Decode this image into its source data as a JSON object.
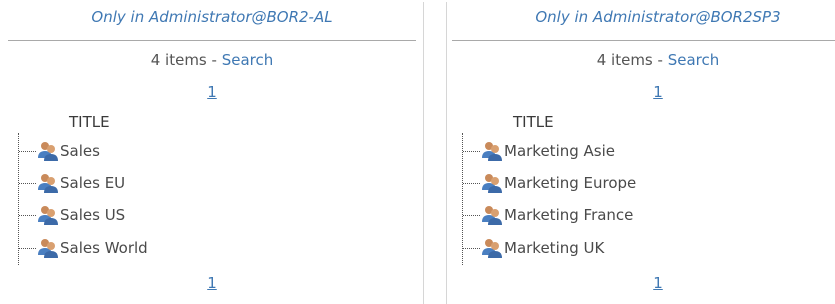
{
  "left": {
    "title": "Only in Administrator@BOR2-AL",
    "items_count": "4 items",
    "separator": " - ",
    "search_link": "Search",
    "page_top": "1",
    "page_bottom": "1",
    "column_header": "TITLE",
    "rows": [
      {
        "label": "Sales",
        "icon": "group-icon"
      },
      {
        "label": "Sales EU",
        "icon": "group-icon"
      },
      {
        "label": "Sales US",
        "icon": "group-icon"
      },
      {
        "label": "Sales World",
        "icon": "group-icon"
      }
    ]
  },
  "right": {
    "title": "Only in Administrator@BOR2SP3",
    "items_count": "4 items",
    "separator": " - ",
    "search_link": "Search",
    "page_top": "1",
    "page_bottom": "1",
    "column_header": "TITLE",
    "rows": [
      {
        "label": "Marketing Asie",
        "icon": "group-icon"
      },
      {
        "label": "Marketing Europe",
        "icon": "group-icon"
      },
      {
        "label": "Marketing France",
        "icon": "group-icon"
      },
      {
        "label": "Marketing UK",
        "icon": "group-icon"
      }
    ]
  },
  "colors": {
    "link": "#3f78b3",
    "text": "#4a4a4a",
    "divider": "#a9a9a9"
  }
}
